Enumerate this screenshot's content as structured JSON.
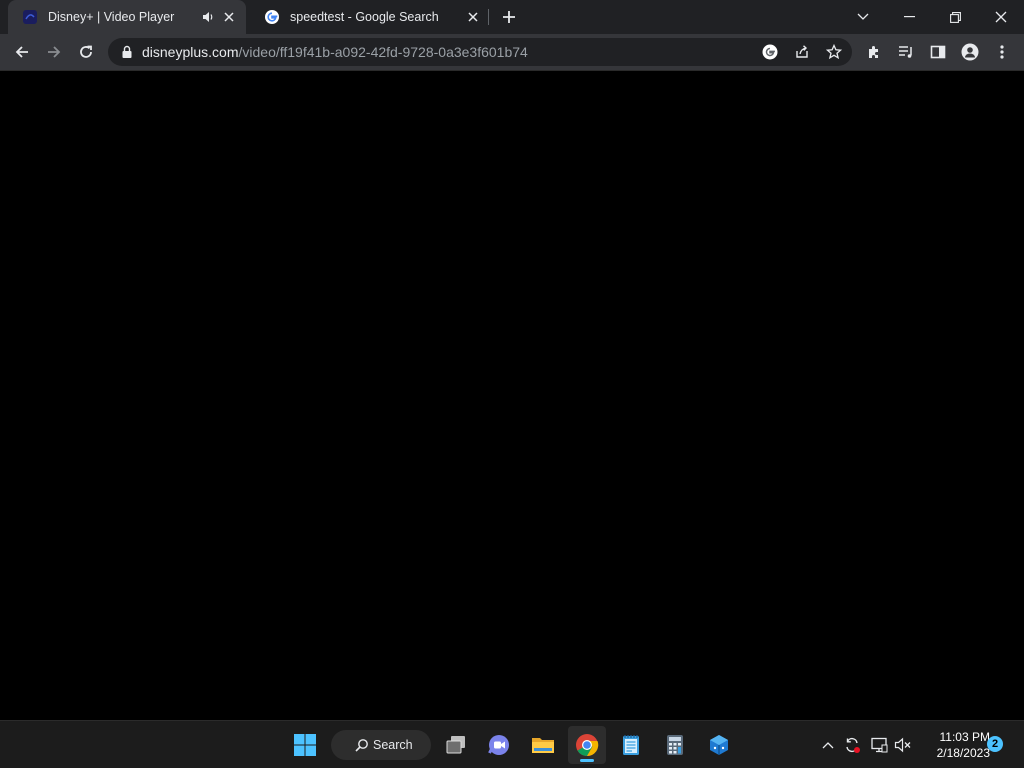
{
  "browser": {
    "tabs": [
      {
        "title": "Disney+ | Video Player",
        "favicon": "disney-plus-icon",
        "audio": "speaker-icon",
        "active": true
      },
      {
        "title": "speedtest - Google Search",
        "favicon": "google-icon",
        "active": false
      }
    ],
    "url": {
      "host": "disneyplus.com",
      "path": "/video/ff19f41b-a092-42fd-9728-0a3e3f601b74"
    }
  },
  "taskbar": {
    "search_label": "Search",
    "apps": [
      "start-icon",
      "task-view-icon",
      "chat-icon",
      "file-explorer-icon",
      "chrome-icon",
      "notepad-icon",
      "calculator-icon",
      "app-icon"
    ],
    "active_app": "chrome-icon",
    "clock": {
      "time": "11:03 PM",
      "date": "2/18/2023"
    },
    "notification_count": "2"
  },
  "colors": {
    "tab_strip": "#202124",
    "toolbar": "#35363a",
    "content": "#000000",
    "taskbar": "#1c1c1c",
    "accent": "#4cc2ff"
  }
}
